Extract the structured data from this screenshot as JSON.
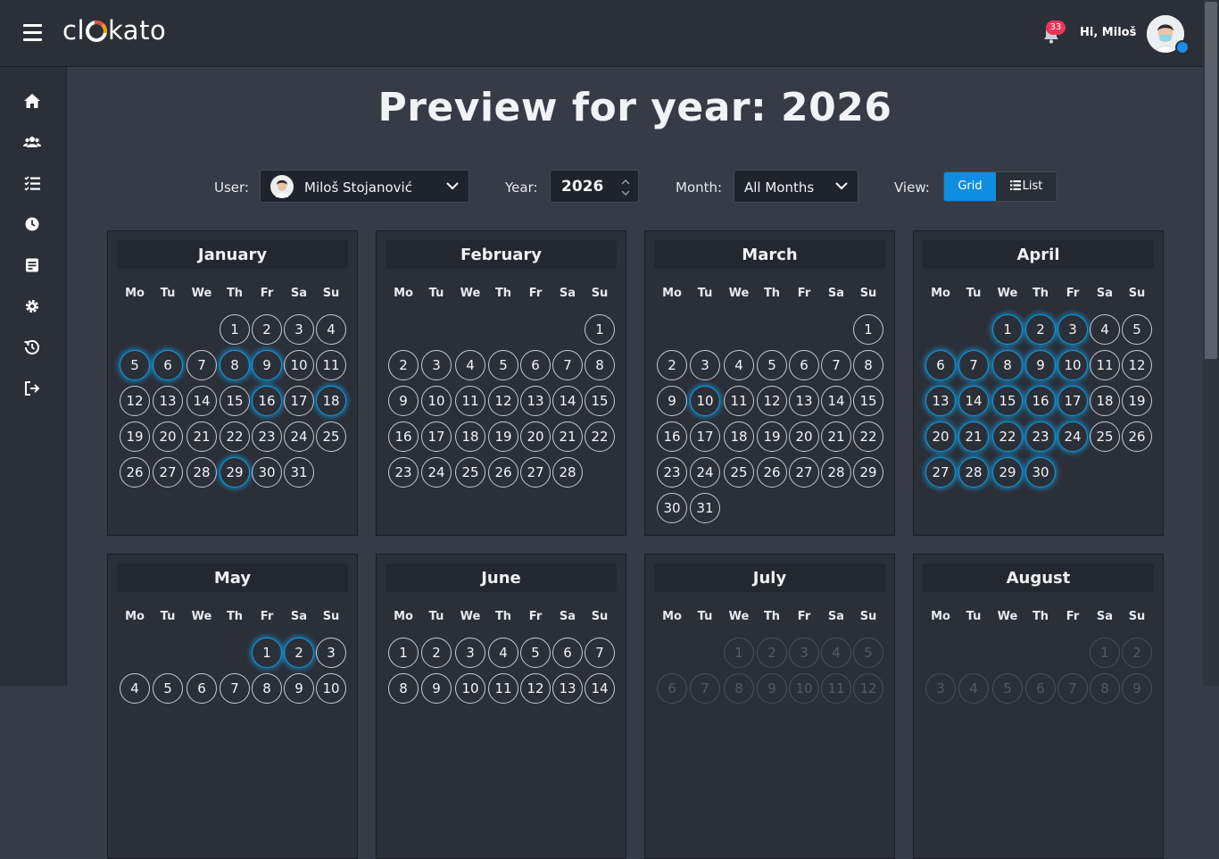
{
  "app": {
    "logo_text": [
      "cl",
      "kato"
    ],
    "notifications_count": "33",
    "greeting": "Hi, Miloš"
  },
  "page": {
    "title": "Preview for year: 2026"
  },
  "filters": {
    "user_label": "User:",
    "user_value": "Miloš Stojanović",
    "year_label": "Year:",
    "year_value": "2026",
    "month_label": "Month:",
    "month_value": "All Months",
    "view_label": "View:",
    "view_grid": "Grid",
    "view_list": "List",
    "view_selected": "Grid"
  },
  "weekdays": [
    "Mo",
    "Tu",
    "We",
    "Th",
    "Fr",
    "Sa",
    "Su"
  ],
  "colors": {
    "accent": "#0d8ee0",
    "highlight": "#149de0",
    "background": "#363b46",
    "panel": "#2b2f38"
  },
  "sidebar": {
    "items": [
      {
        "icon": "home-icon"
      },
      {
        "icon": "users-icon"
      },
      {
        "icon": "tasks-list-icon"
      },
      {
        "icon": "clock-icon"
      },
      {
        "icon": "report-icon"
      },
      {
        "icon": "gear-icon"
      },
      {
        "icon": "history-icon"
      },
      {
        "icon": "logout-icon"
      }
    ]
  },
  "months": [
    {
      "name": "January",
      "first_weekday": 3,
      "days": 31,
      "highlighted": [
        5,
        6,
        8,
        9,
        16,
        18,
        29
      ]
    },
    {
      "name": "February",
      "first_weekday": 6,
      "days": 28,
      "highlighted": []
    },
    {
      "name": "March",
      "first_weekday": 6,
      "days": 31,
      "highlighted": [
        10
      ]
    },
    {
      "name": "April",
      "first_weekday": 2,
      "days": 30,
      "highlighted": [
        1,
        2,
        3,
        6,
        7,
        8,
        9,
        10,
        13,
        14,
        15,
        16,
        17,
        20,
        21,
        22,
        23,
        24,
        27,
        28,
        29,
        30
      ]
    },
    {
      "name": "May",
      "first_weekday": 4,
      "days": 31,
      "highlighted": [
        1,
        2
      ],
      "visible_rows": 2
    },
    {
      "name": "June",
      "first_weekday": 0,
      "days": 30,
      "highlighted": [],
      "visible_rows": 2
    },
    {
      "name": "July",
      "first_weekday": 2,
      "days": 31,
      "highlighted": [],
      "dimmed": true,
      "visible_rows": 2
    },
    {
      "name": "August",
      "first_weekday": 5,
      "days": 31,
      "highlighted": [],
      "dimmed": true,
      "visible_rows": 2
    }
  ]
}
